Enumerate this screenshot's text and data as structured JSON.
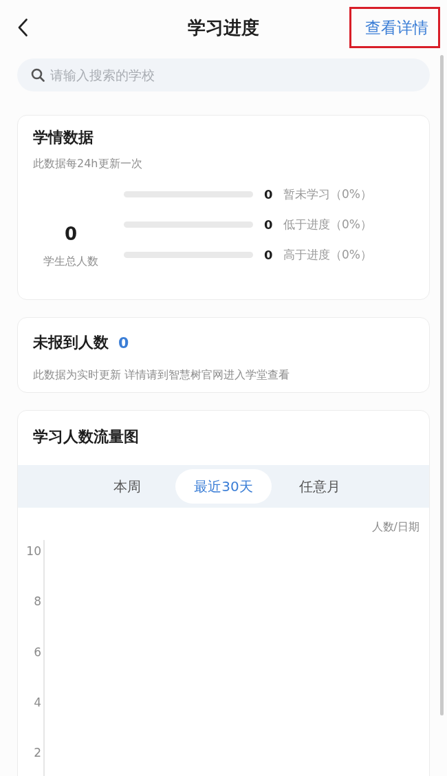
{
  "header": {
    "title": "学习进度",
    "detail_link": {
      "label": "查看详情",
      "highlighted": true
    }
  },
  "search": {
    "placeholder": "请输入搜索的学校"
  },
  "learning_stats": {
    "title": "学情数据",
    "subtitle": "此数据每24h更新一次",
    "total": {
      "value": "0",
      "label": "学生总人数"
    },
    "rows": [
      {
        "count": "0",
        "label": "暂未学习（0%）",
        "level": 0
      },
      {
        "count": "0",
        "label": "低于进度（0%）",
        "level": 0
      },
      {
        "count": "0",
        "label": "高于进度（0%）",
        "level": 0
      }
    ]
  },
  "unreported": {
    "title": "未报到人数",
    "count": "0",
    "note": "此数据为实时更新 详情请到智慧树官网进入学堂查看"
  },
  "flow_chart": {
    "title": "学习人数流量图",
    "tabs": [
      {
        "label": "本周",
        "selected": false
      },
      {
        "label": "最近30天",
        "selected": true
      },
      {
        "label": "任意月",
        "selected": false
      }
    ],
    "y_axis": {
      "unit": "人数/日期",
      "ticks": [
        "10",
        "8",
        "6",
        "4",
        "2"
      ]
    }
  }
}
